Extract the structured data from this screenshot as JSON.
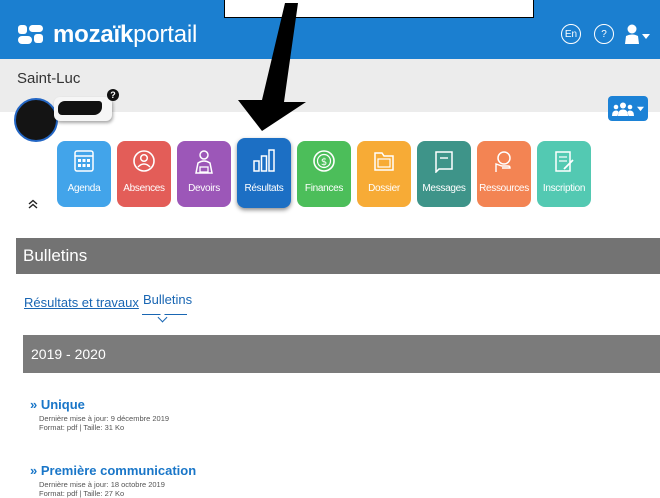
{
  "brand": {
    "name_bold": "mozaïk",
    "name_light": "portail"
  },
  "topbar": {
    "lang_label": "En",
    "help_label": "?"
  },
  "school": {
    "name": "Saint-Luc",
    "help_badge": "?"
  },
  "tiles": [
    {
      "label": "Agenda",
      "color": "#42a4ea",
      "icon": "calendar-icon"
    },
    {
      "label": "Absences",
      "color": "#e35d58",
      "icon": "person-circle-icon"
    },
    {
      "label": "Devoirs",
      "color": "#9c57b8",
      "icon": "student-icon"
    },
    {
      "label": "Résultats",
      "color": "#1c6fc4",
      "icon": "bar-chart-icon",
      "active": true
    },
    {
      "label": "Finances",
      "color": "#4cbe5a",
      "icon": "coin-icon"
    },
    {
      "label": "Dossier",
      "color": "#f7ab36",
      "icon": "folder-icon"
    },
    {
      "label": "Messages",
      "color": "#3e9489",
      "icon": "message-icon"
    },
    {
      "label": "Ressources",
      "color": "#f38453",
      "icon": "hand-coin-icon"
    },
    {
      "label": "Inscription",
      "color": "#53c9b2",
      "icon": "form-icon"
    }
  ],
  "section": {
    "title": "Bulletins"
  },
  "tabs": {
    "results": "Résultats et travaux",
    "bulletins": "Bulletins"
  },
  "year": {
    "label": "2019 - 2020"
  },
  "documents": [
    {
      "title": "» Unique",
      "updated": "Dernière mise à jour: 9 décembre 2019",
      "format": "Format: pdf | Taille: 31 Ko"
    },
    {
      "title": "» Première communication",
      "updated": "Dernière mise à jour: 18 octobre 2019",
      "format": "Format: pdf | Taille: 27 Ko"
    }
  ]
}
